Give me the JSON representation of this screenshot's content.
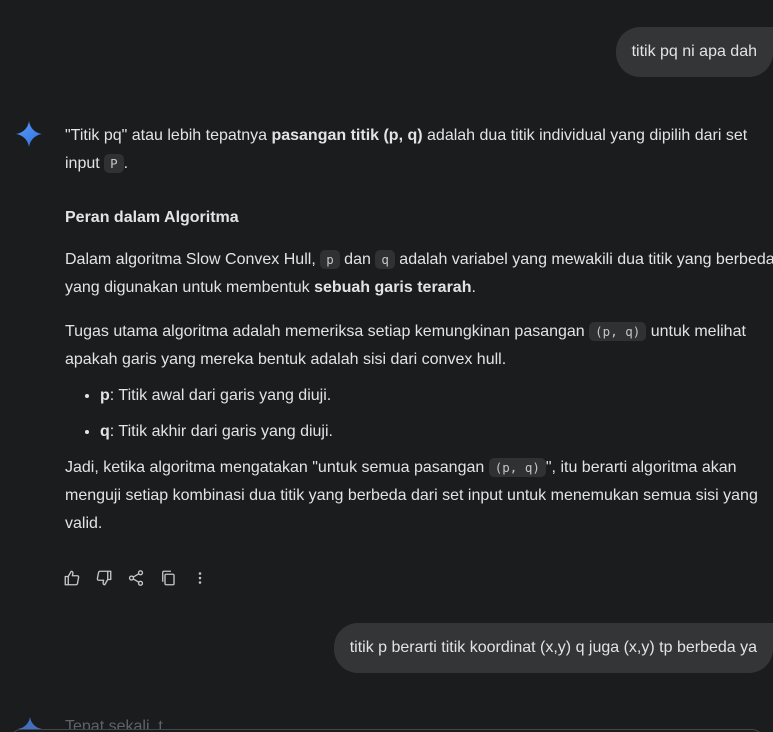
{
  "conversation": {
    "user_message_1": "titik pq ni apa dah",
    "user_message_2": "titik p berarti titik koordinat (x,y) q juga (x,y) tp berbeda ya",
    "next_response_peek": "Tepat sekali, t"
  },
  "response": {
    "p1_a": "\"Titik pq\" atau lebih tepatnya ",
    "p1_bold": "pasangan titik (p, q)",
    "p1_b": " adalah dua titik individual yang dipilih dari set input ",
    "p1_code": "P",
    "p1_c": ".",
    "heading": "Peran dalam Algoritma",
    "p2_a": "Dalam algoritma Slow Convex Hull, ",
    "p2_code1": "p",
    "p2_b": " dan ",
    "p2_code2": "q",
    "p2_c": " adalah variabel yang mewakili dua titik yang berbeda yang digunakan untuk membentuk ",
    "p2_bold": "sebuah garis terarah",
    "p2_d": ".",
    "p3_a": "Tugas utama algoritma adalah memeriksa setiap kemungkinan pasangan ",
    "p3_code": "(p, q)",
    "p3_b": " untuk melihat apakah garis yang mereka bentuk adalah sisi dari convex hull.",
    "bullets": [
      {
        "term": "p",
        "text": ": Titik awal dari garis yang diuji."
      },
      {
        "term": "q",
        "text": ": Titik akhir dari garis yang diuji."
      }
    ],
    "p4_a": "Jadi, ketika algoritma mengatakan \"untuk semua pasangan ",
    "p4_code": "(p, q)",
    "p4_b": "\", itu berarti algoritma akan menguji setiap kombinasi dua titik yang berbeda dari set input untuk menemukan semua sisi yang valid."
  },
  "actions": {
    "icons": [
      "thumbs-up-icon",
      "thumbs-down-icon",
      "share-icon",
      "copy-icon",
      "more-vert-icon"
    ]
  },
  "colors": {
    "background": "#1b1c1d",
    "bubble": "#333537",
    "text": "#e3e3e3",
    "code_bg": "#2f3133",
    "gemini_blue": "#4285f4"
  }
}
